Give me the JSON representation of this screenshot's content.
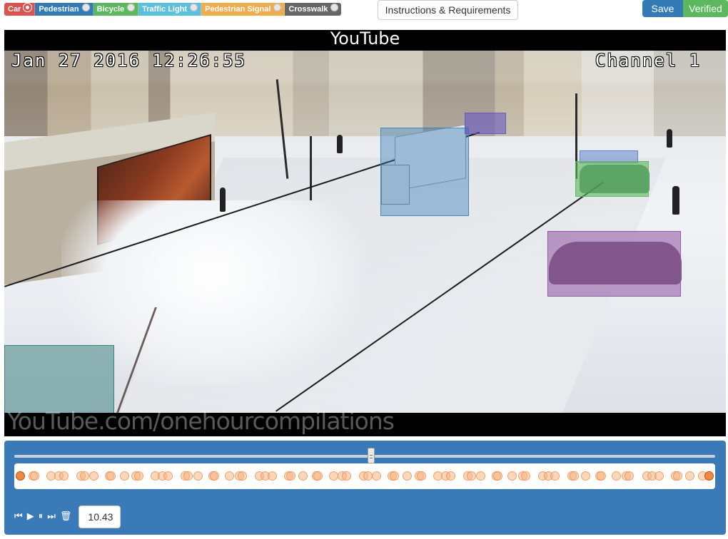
{
  "labels": [
    {
      "name": "Car",
      "color": "#d9534f",
      "active": true
    },
    {
      "name": "Pedestrian",
      "color": "#337ab7",
      "active": false
    },
    {
      "name": "Bicycle",
      "color": "#5cb85c",
      "active": false
    },
    {
      "name": "Traffic Light",
      "color": "#5bc0de",
      "active": false
    },
    {
      "name": "Pedestrian Signal",
      "color": "#f0ad4e",
      "active": false
    },
    {
      "name": "Crosswalk",
      "color": "#666666",
      "active": false
    }
  ],
  "toolbar": {
    "instructions_label": "Instructions & Requirements",
    "save_label": "Save",
    "verified_label": "Verified"
  },
  "video": {
    "logo_text": "YouTube",
    "timestamp": "Jan 27 2016 12:26:55",
    "channel": "Channel 1",
    "watermark": "YouTube.com/onehourcompilations"
  },
  "player": {
    "scrub_progress": 0.509,
    "time_value": "10.43",
    "keyframe_count": 74,
    "strong_keyframes": [
      0,
      73
    ]
  }
}
